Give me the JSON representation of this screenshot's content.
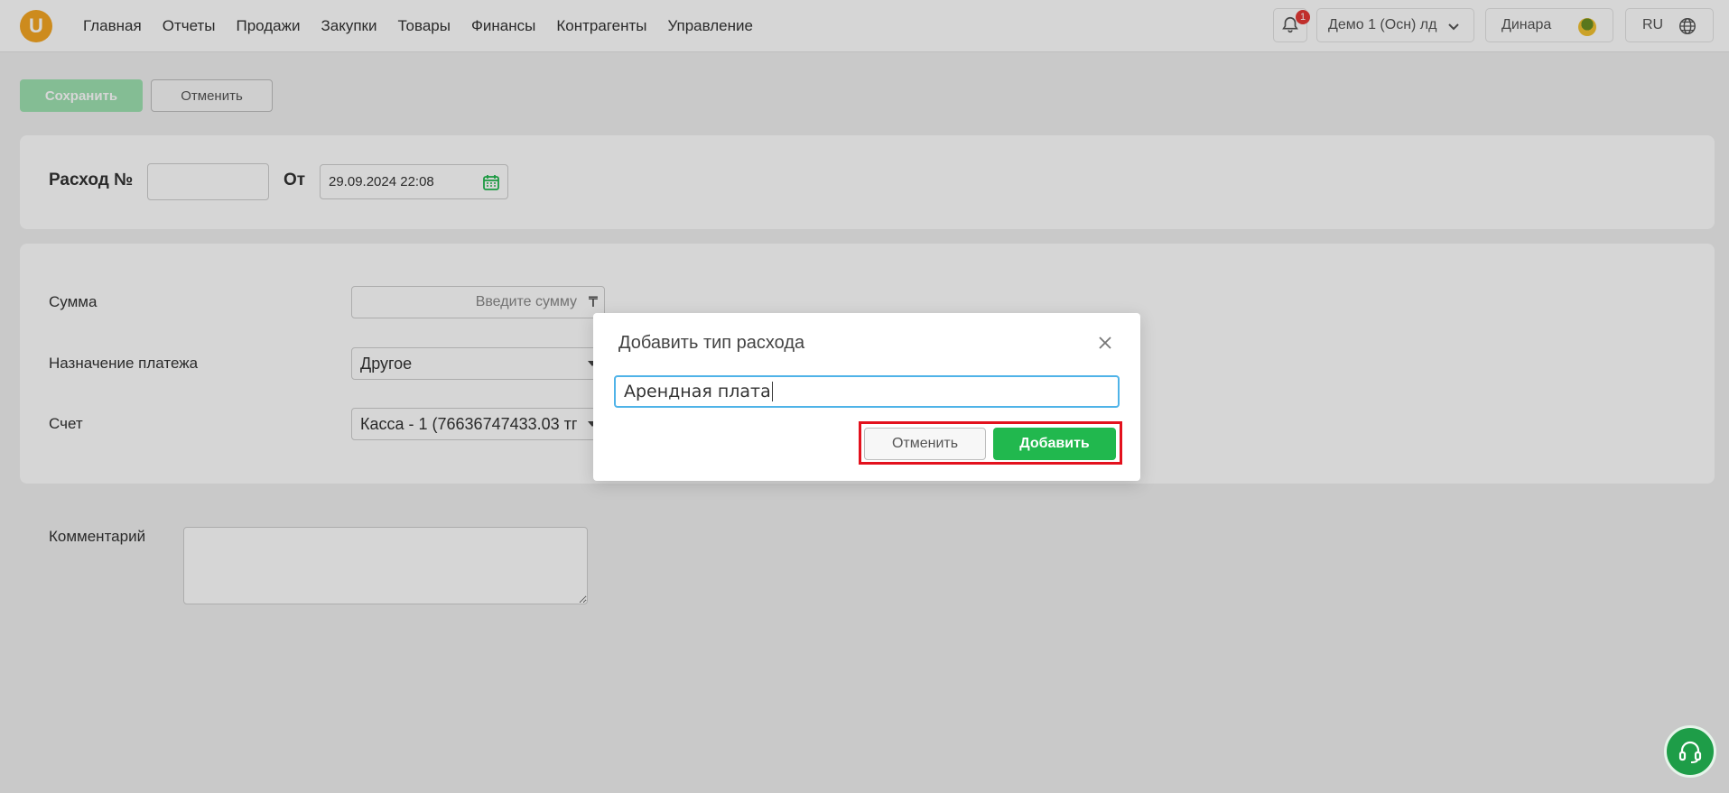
{
  "app": {
    "logo_letter": "U"
  },
  "nav": {
    "items": [
      "Главная",
      "Отчеты",
      "Продажи",
      "Закупки",
      "Товары",
      "Финансы",
      "Контрагенты",
      "Управление"
    ]
  },
  "header": {
    "notifications_count": "1",
    "organization": "Демо 1 (Осн) лд",
    "user_name": "Динара",
    "language": "RU"
  },
  "toolbar": {
    "save_label": "Сохранить",
    "cancel_label": "Отменить"
  },
  "doc": {
    "title_label": "Расход №",
    "number_value": "",
    "from_label": "От",
    "date_value": "29.09.2024 22:08"
  },
  "form": {
    "amount_label": "Сумма",
    "amount_placeholder": "Введите сумму",
    "currency_symbol": "₸",
    "purpose_label": "Назначение платежа",
    "purpose_value": "Другое",
    "account_label": "Счет",
    "account_value": "Касса - 1 (76636747433.03 тг",
    "comment_label": "Комментарий"
  },
  "modal": {
    "title": "Добавить тип расхода",
    "input_value": "Арендная плата",
    "cancel_label": "Отменить",
    "add_label": "Добавить"
  },
  "colors": {
    "accent_green": "#21b84e",
    "highlight_red": "#e3111d",
    "input_focus_blue": "#4fb3e8"
  }
}
